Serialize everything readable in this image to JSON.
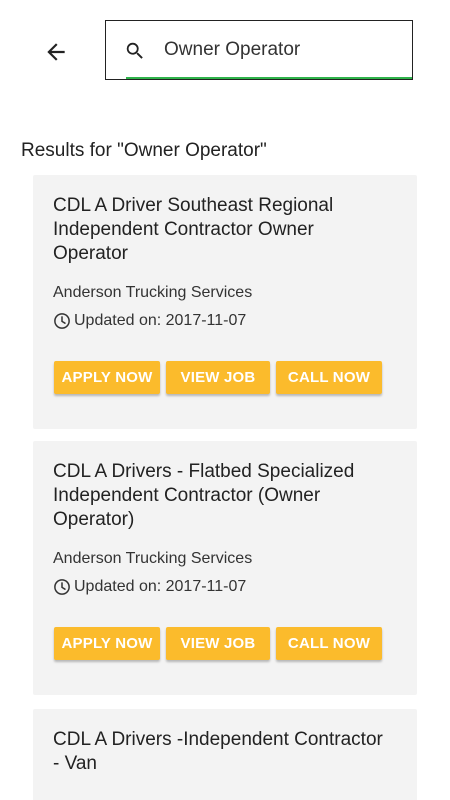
{
  "search": {
    "query": "Owner Operator"
  },
  "results_heading": "Results for \"Owner Operator\"",
  "jobs": [
    {
      "title": "CDL A Driver Southeast Regional Independent Contractor Owner Operator",
      "company": "Anderson Trucking Services",
      "updated": "Updated on: 2017-11-07",
      "apply_label": "APPLY NOW",
      "view_label": "VIEW JOB",
      "call_label": "CALL NOW"
    },
    {
      "title": "CDL A Drivers - Flatbed Specialized Independent Contractor (Owner Operator)",
      "company": "Anderson Trucking Services",
      "updated": "Updated on: 2017-11-07",
      "apply_label": "APPLY NOW",
      "view_label": "VIEW JOB",
      "call_label": "CALL NOW"
    },
    {
      "title": "CDL A Drivers -Independent Contractor - Van"
    }
  ],
  "icons": {
    "back": "arrow-left-icon",
    "search": "search-icon",
    "clock": "clock-icon"
  },
  "colors": {
    "accent_button": "#fbbb2c",
    "search_underline": "#2fb34a",
    "card_background": "#f3f3f3"
  }
}
